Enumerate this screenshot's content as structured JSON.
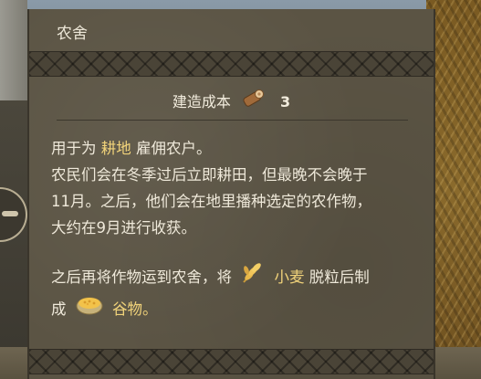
{
  "panel": {
    "title": "农舍",
    "cost": {
      "label": "建造成本",
      "resource_icon": "wood-log-icon",
      "value": "3"
    }
  },
  "description": {
    "line1_prefix": "用于为",
    "line1_highlight": "耕地",
    "line1_suffix": "雇佣农户。",
    "line2": "农民们会在冬季过后立即耕田，但最晚不会晚于",
    "line3": "11月。之后，他们会在地里播种选定的农作物，",
    "line4": "大约在9月进行收获。",
    "line5_prefix": "之后再将作物运到农舍，将",
    "line5_icon": "wheat-icon",
    "line5_highlight": "小麦",
    "line5_suffix": "脱粒后制",
    "line6_prefix": "成",
    "line6_icon": "grain-bowl-icon",
    "line6_highlight": "谷物。"
  },
  "colors": {
    "highlight": "#f1d37a",
    "text": "#efe9da",
    "panel_bg": "#5b5444"
  }
}
